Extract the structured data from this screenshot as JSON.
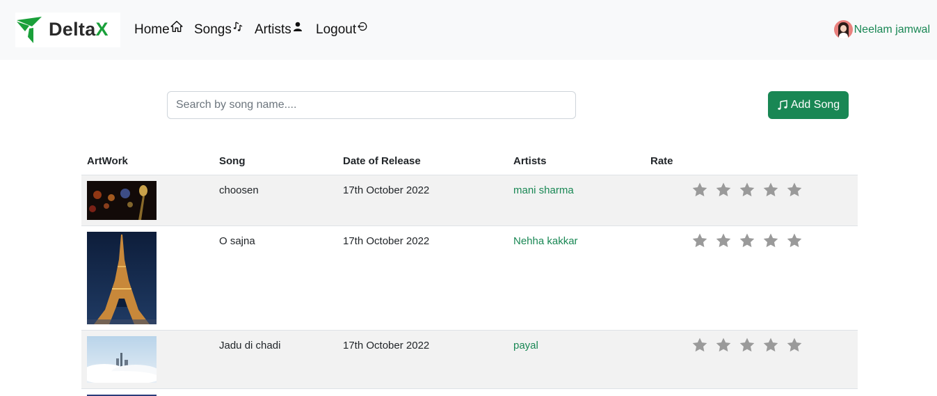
{
  "brand": {
    "name_main": "Delta",
    "name_accent": "X",
    "accent_color": "#1aa03a"
  },
  "nav": {
    "items": [
      {
        "label": "Home",
        "icon": "house-icon"
      },
      {
        "label": "Songs",
        "icon": "music-notes-icon"
      },
      {
        "label": "Artists",
        "icon": "person-icon"
      },
      {
        "label": "Logout",
        "icon": "logout-icon"
      }
    ]
  },
  "user": {
    "name": "Neelam jamwal",
    "color": "#198754"
  },
  "search": {
    "placeholder": "Search by song name....",
    "value": ""
  },
  "add_button": {
    "label": "Add Song",
    "icon": "music-note-icon",
    "color": "#198754"
  },
  "table": {
    "headers": [
      "ArtWork",
      "Song",
      "Date of Release",
      "Artists",
      "Rate"
    ],
    "rows": [
      {
        "artwork": "microphone-stage-image",
        "song": "choosen",
        "date": "17th October 2022",
        "artist": "mani sharma",
        "rating": 0
      },
      {
        "artwork": "eiffel-tower-night-image",
        "song": "O sajna",
        "date": "17th October 2022",
        "artist": "Nehha kakkar",
        "rating": 0
      },
      {
        "artwork": "city-above-clouds-image",
        "song": "Jadu di chadi",
        "date": "17th October 2022",
        "artist": "payal",
        "rating": 0
      }
    ],
    "max_rating": 5,
    "star_color": "#9a9a9a"
  }
}
